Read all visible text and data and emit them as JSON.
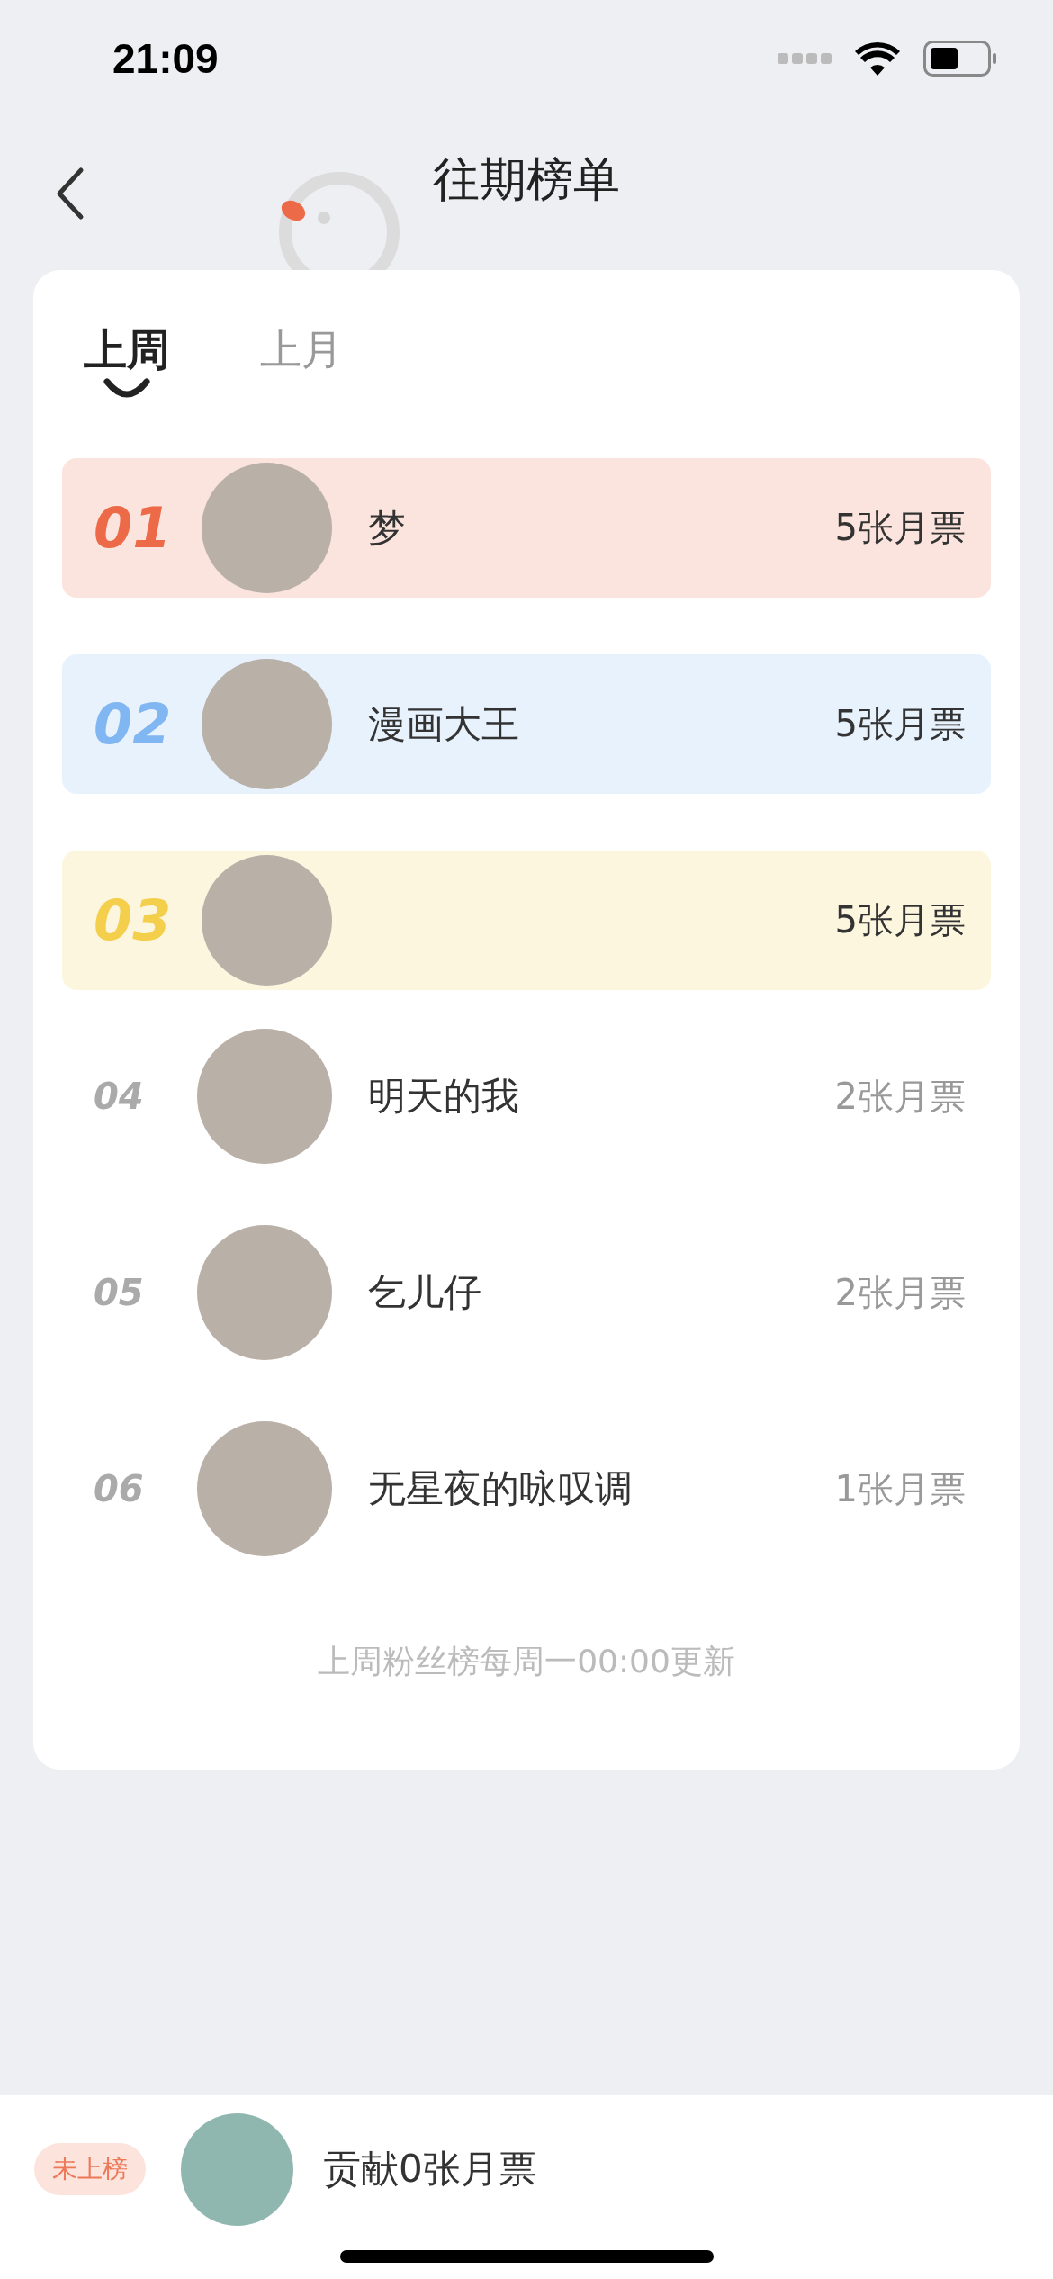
{
  "status_bar": {
    "time": "21:09"
  },
  "nav": {
    "title": "往期榜单"
  },
  "tabs": [
    {
      "label": "上周",
      "selected": true
    },
    {
      "label": "上月",
      "selected": false
    }
  ],
  "rows": [
    {
      "kind": "top",
      "rank": "01",
      "name": "梦",
      "votes": "5张月票",
      "color": "#ec6a47"
    },
    {
      "kind": "top",
      "rank": "02",
      "name": "漫画大王",
      "votes": "5张月票",
      "color": "#80b6f2"
    },
    {
      "kind": "top",
      "rank": "03",
      "votes": "5张月票",
      "color": "#f4cf4c"
    },
    {
      "kind": "normal",
      "rank": "04",
      "name": "明天的我",
      "votes": "2张月票"
    },
    {
      "kind": "normal",
      "rank": "05",
      "name": "乞儿仔",
      "votes": "2张月票"
    },
    {
      "kind": "normal",
      "rank": "06",
      "name": "无星夜的咏叹调",
      "votes": "1张月票"
    }
  ],
  "footer_note": "上周粉丝榜每周一00:00更新",
  "my_rank": {
    "badge": "未上榜",
    "text": "贡献0张月票"
  }
}
